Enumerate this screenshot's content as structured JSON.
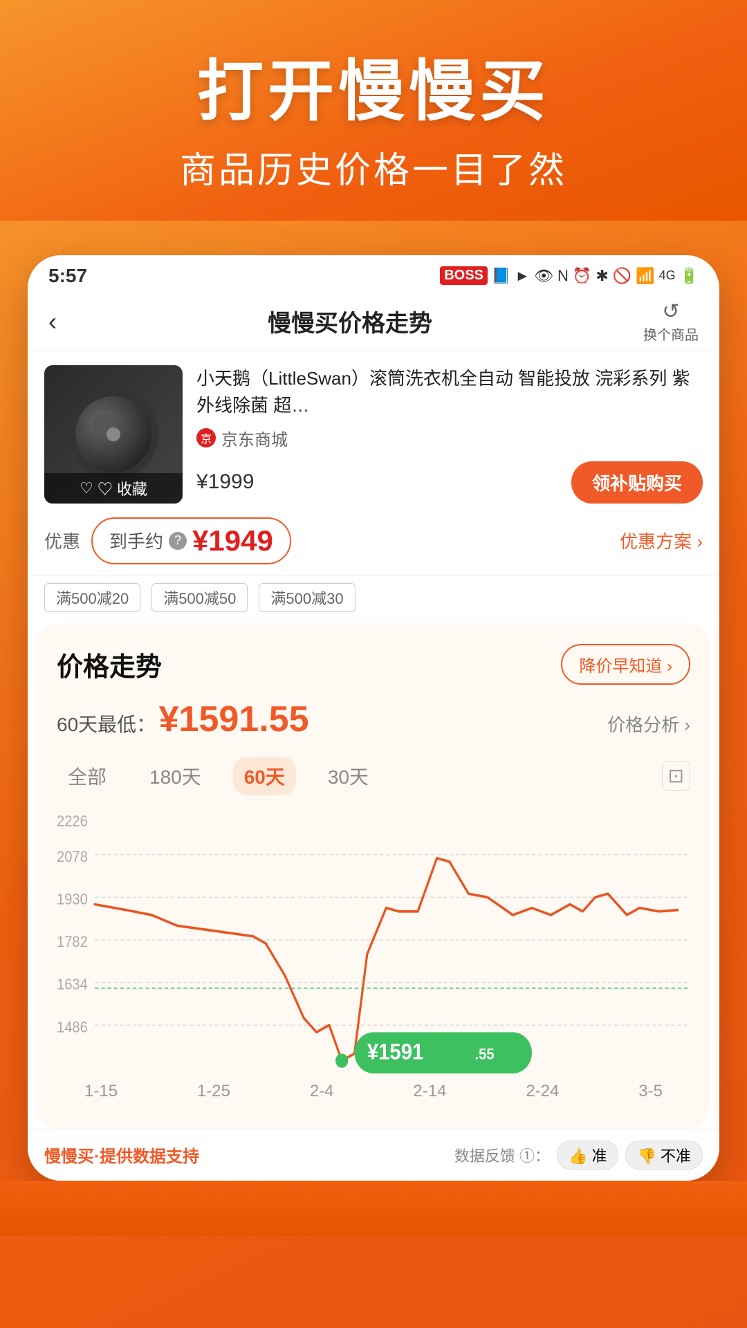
{
  "hero": {
    "title": "打开慢慢买",
    "subtitle": "商品历史价格一目了然"
  },
  "status_bar": {
    "time": "5:57",
    "icons": "BOSS 📘 ► 👁 N ⏰ ✱ 📶 4G"
  },
  "nav": {
    "title": "慢慢买价格走势",
    "refresh_label": "换个商品",
    "back_icon": "‹"
  },
  "product": {
    "name": "小天鹅（LittleSwan）滚筒洗衣机全自动 智能投放 浣彩系列 紫外线除菌 超…",
    "shop": "京东商城",
    "price": "¥1999",
    "buy_btn": "领补贴购买",
    "bookmark_label": "♡ 收藏"
  },
  "discount": {
    "label": "优惠",
    "arrived_label": "到手约",
    "question_icon": "?",
    "arrived_price": "¥1949",
    "link_text": "优惠方案 ›",
    "coupons": [
      "满500减20",
      "满500减50",
      "满500减30"
    ]
  },
  "chart": {
    "title": "价格走势",
    "alert_btn": "降价早知道 ›",
    "lowest_label": "60天最低：",
    "lowest_price": "¥1591.55",
    "analysis_link": "价格分析 ›",
    "time_tabs": [
      "全部",
      "180天",
      "60天",
      "30天"
    ],
    "active_tab": "60天",
    "y_labels": [
      "2226",
      "2078",
      "1930",
      "1782",
      "1634",
      "1486"
    ],
    "x_labels": [
      "1-15",
      "1-25",
      "2-4",
      "2-14",
      "2-24",
      "3-5"
    ],
    "current_price_label": "¥1591",
    "current_price_small": ".55"
  },
  "bottom": {
    "brand": "慢慢买·提供数据支持",
    "feedback_label": "数据反馈 ①：",
    "thumbs_up": "👍 准",
    "thumbs_down": "👎 不准"
  }
}
